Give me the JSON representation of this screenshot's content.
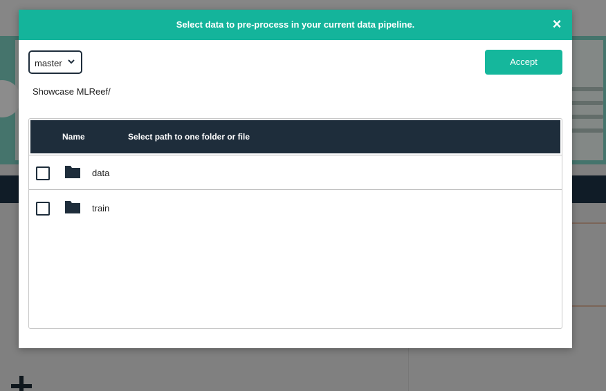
{
  "modal": {
    "title": "Select data to pre-process in your current data pipeline.",
    "close_symbol": "×",
    "branch": {
      "selected": "master"
    },
    "accept_label": "Accept",
    "breadcrumb": "Showcase MLReef/",
    "table": {
      "columns": [
        "Name",
        "Select path to one folder or file"
      ],
      "rows": [
        {
          "name": "data",
          "type": "folder",
          "checked": false
        },
        {
          "name": "train",
          "type": "folder",
          "checked": false
        }
      ]
    }
  },
  "colors": {
    "header": "#14b49b",
    "accept": "#15b79c",
    "table_head": "#1e2d3b"
  },
  "icons": [
    "close-icon",
    "chevron-down-icon",
    "folder-icon"
  ]
}
